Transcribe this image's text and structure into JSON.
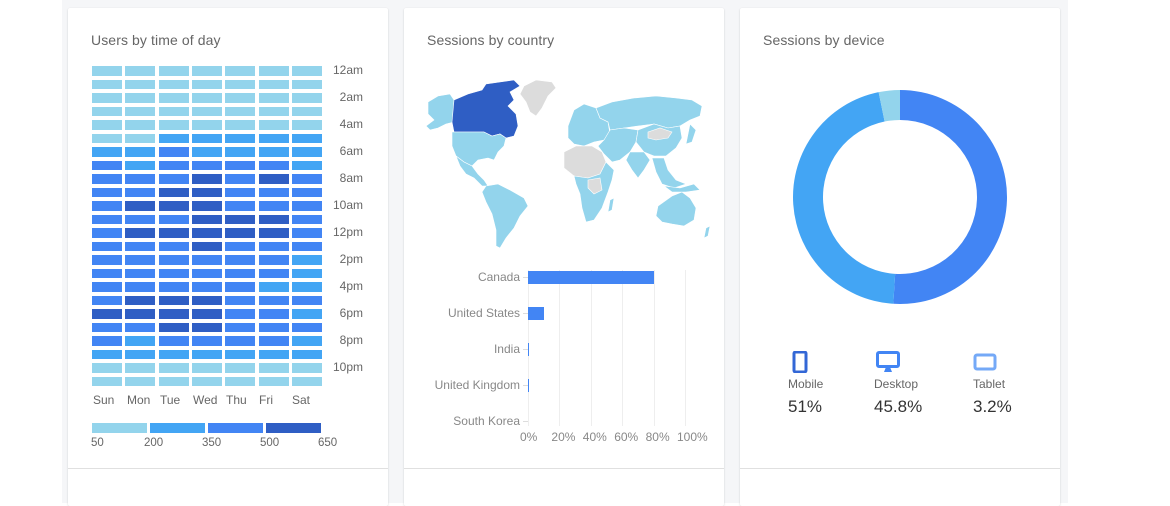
{
  "cards": {
    "time": {
      "title": "Users by time of day"
    },
    "country": {
      "title": "Sessions by country"
    },
    "device": {
      "title": "Sessions by device"
    }
  },
  "colors": {
    "level1": "#93d4ec",
    "level2": "#43a5f4",
    "level3": "#4285f4",
    "level4": "#2f5ec4",
    "map_highlight": "#2f5ec4",
    "map_data": "#93d4ec",
    "map_nodata": "#dcdcdc",
    "bar": "#4285f4",
    "donut_mobile": "#4285f4",
    "donut_desktop": "#43a5f4",
    "donut_tablet": "#93d4ec"
  },
  "chart_data": [
    {
      "type": "heatmap",
      "title": "Users by time of day",
      "x": [
        "Sun",
        "Mon",
        "Tue",
        "Wed",
        "Thu",
        "Fri",
        "Sat"
      ],
      "y_labels": [
        "12am",
        "2am",
        "4am",
        "6am",
        "8am",
        "10am",
        "12pm",
        "2pm",
        "4pm",
        "6pm",
        "8pm",
        "10pm"
      ],
      "hours": 24,
      "legend_ticks": [
        "50",
        "200",
        "350",
        "500",
        "650"
      ],
      "legend_bins": [
        [
          50,
          200
        ],
        [
          200,
          350
        ],
        [
          350,
          500
        ],
        [
          500,
          650
        ]
      ],
      "levels": [
        [
          1,
          1,
          1,
          1,
          1,
          1,
          1
        ],
        [
          1,
          1,
          1,
          1,
          1,
          1,
          1
        ],
        [
          1,
          1,
          1,
          1,
          1,
          1,
          1
        ],
        [
          1,
          1,
          1,
          1,
          1,
          1,
          1
        ],
        [
          1,
          1,
          1,
          1,
          1,
          1,
          1
        ],
        [
          1,
          1,
          2,
          2,
          2,
          2,
          2
        ],
        [
          2,
          2,
          3,
          2,
          2,
          2,
          2
        ],
        [
          3,
          2,
          3,
          3,
          3,
          3,
          2
        ],
        [
          3,
          3,
          3,
          4,
          3,
          4,
          3
        ],
        [
          3,
          3,
          4,
          4,
          3,
          3,
          3
        ],
        [
          3,
          4,
          4,
          4,
          3,
          3,
          3
        ],
        [
          3,
          3,
          3,
          4,
          4,
          4,
          3
        ],
        [
          3,
          4,
          4,
          4,
          4,
          4,
          3
        ],
        [
          3,
          3,
          3,
          4,
          3,
          3,
          3
        ],
        [
          3,
          3,
          3,
          3,
          3,
          3,
          2
        ],
        [
          3,
          3,
          3,
          3,
          3,
          3,
          2
        ],
        [
          3,
          3,
          3,
          3,
          3,
          2,
          2
        ],
        [
          3,
          4,
          4,
          4,
          3,
          3,
          3
        ],
        [
          4,
          4,
          4,
          4,
          3,
          3,
          2
        ],
        [
          3,
          3,
          4,
          4,
          3,
          3,
          3
        ],
        [
          3,
          2,
          3,
          3,
          3,
          3,
          2
        ],
        [
          2,
          2,
          2,
          2,
          2,
          2,
          2
        ],
        [
          1,
          1,
          1,
          1,
          1,
          1,
          1
        ],
        [
          1,
          1,
          1,
          1,
          1,
          1,
          1
        ]
      ]
    },
    {
      "type": "bar",
      "orientation": "horizontal",
      "title": "Sessions by country",
      "categories": [
        "Canada",
        "United States",
        "India",
        "United Kingdom",
        "South Korea"
      ],
      "values": [
        80.5,
        10.2,
        0.5,
        0.5,
        0.1
      ],
      "xlim": [
        0,
        100
      ],
      "x_ticks": [
        "0%",
        "20%",
        "40%",
        "60%",
        "80%",
        "100%"
      ],
      "grid": true
    },
    {
      "type": "pie",
      "donut": true,
      "title": "Sessions by device",
      "categories": [
        "Mobile",
        "Desktop",
        "Tablet"
      ],
      "values": [
        51,
        45.8,
        3.2
      ],
      "labels": [
        "51%",
        "45.8%",
        "3.2%"
      ]
    }
  ],
  "map": {
    "highlighted_country": "Canada",
    "countries_with_data": [
      "United States",
      "Mexico",
      "South America",
      "Europe",
      "Russia",
      "China",
      "India",
      "Australia",
      "Africa (partial)"
    ],
    "countries_without_data": [
      "Greenland",
      "Mongolia",
      "North/Central Africa (partial)"
    ]
  },
  "devices": [
    {
      "name": "Mobile",
      "value": "51%",
      "icon": "mobile-icon"
    },
    {
      "name": "Desktop",
      "value": "45.8%",
      "icon": "desktop-icon"
    },
    {
      "name": "Tablet",
      "value": "3.2%",
      "icon": "tablet-icon"
    }
  ]
}
